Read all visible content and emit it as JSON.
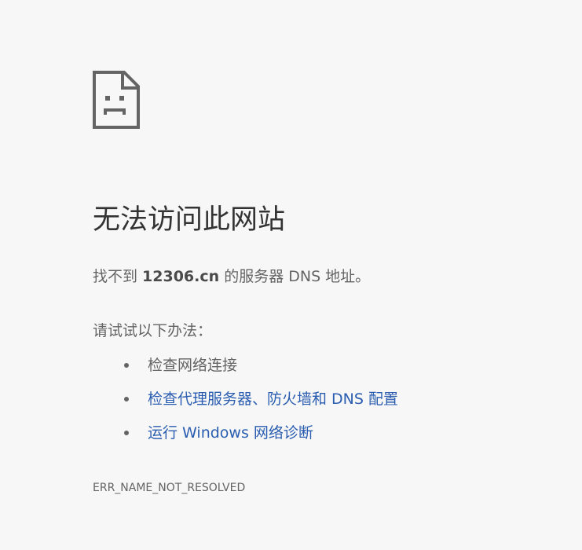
{
  "icon": "sad-document-icon",
  "title": "无法访问此网站",
  "summary": {
    "prefix": "找不到 ",
    "host": "12306.cn",
    "suffix": " 的服务器 DNS 地址。"
  },
  "suggestions_intro": "请试试以下办法：",
  "suggestions": [
    {
      "label": "检查网络连接",
      "is_link": false
    },
    {
      "label": "检查代理服务器、防火墙和 DNS 配置",
      "is_link": true
    },
    {
      "label": "运行 Windows 网络诊断",
      "is_link": true
    }
  ],
  "colors": {
    "background": "#f7f7f7",
    "title": "#333333",
    "text": "#646464",
    "link": "#2a5db0"
  },
  "error_code": "ERR_NAME_NOT_RESOLVED"
}
